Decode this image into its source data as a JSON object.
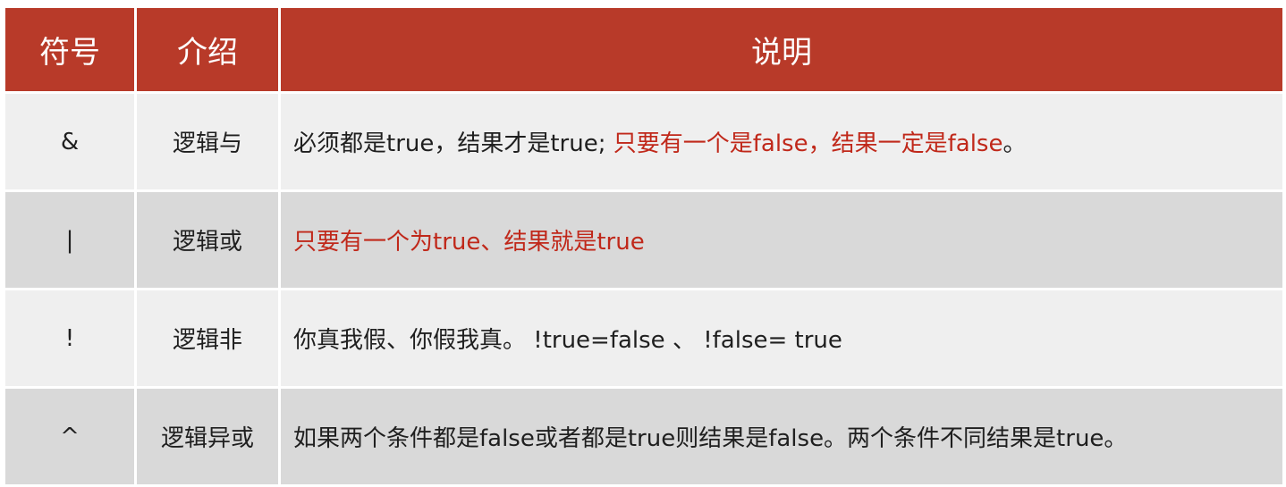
{
  "header": {
    "col_symbol": "符号",
    "col_intro": "介绍",
    "col_desc": "说明"
  },
  "rows": [
    {
      "symbol": "&",
      "intro": "逻辑与",
      "desc_black": "必须都是true，结果才是true; ",
      "desc_red": "只要有一个是false，结果一定是false",
      "desc_tail": "。"
    },
    {
      "symbol": "|",
      "intro": "逻辑或",
      "desc_red": "只要有一个为true、结果就是true"
    },
    {
      "symbol": "!",
      "intro": "逻辑非",
      "desc": "你真我假、你假我真。 !true=false 、 !false= true"
    },
    {
      "symbol": "^",
      "intro": "逻辑异或",
      "desc": "如果两个条件都是false或者都是true则结果是false。两个条件不同结果是true。"
    }
  ],
  "colors": {
    "header_bg": "#b83a29",
    "row_light": "#efefef",
    "row_dark": "#d9d9d9",
    "highlight_red": "#c0281a"
  }
}
